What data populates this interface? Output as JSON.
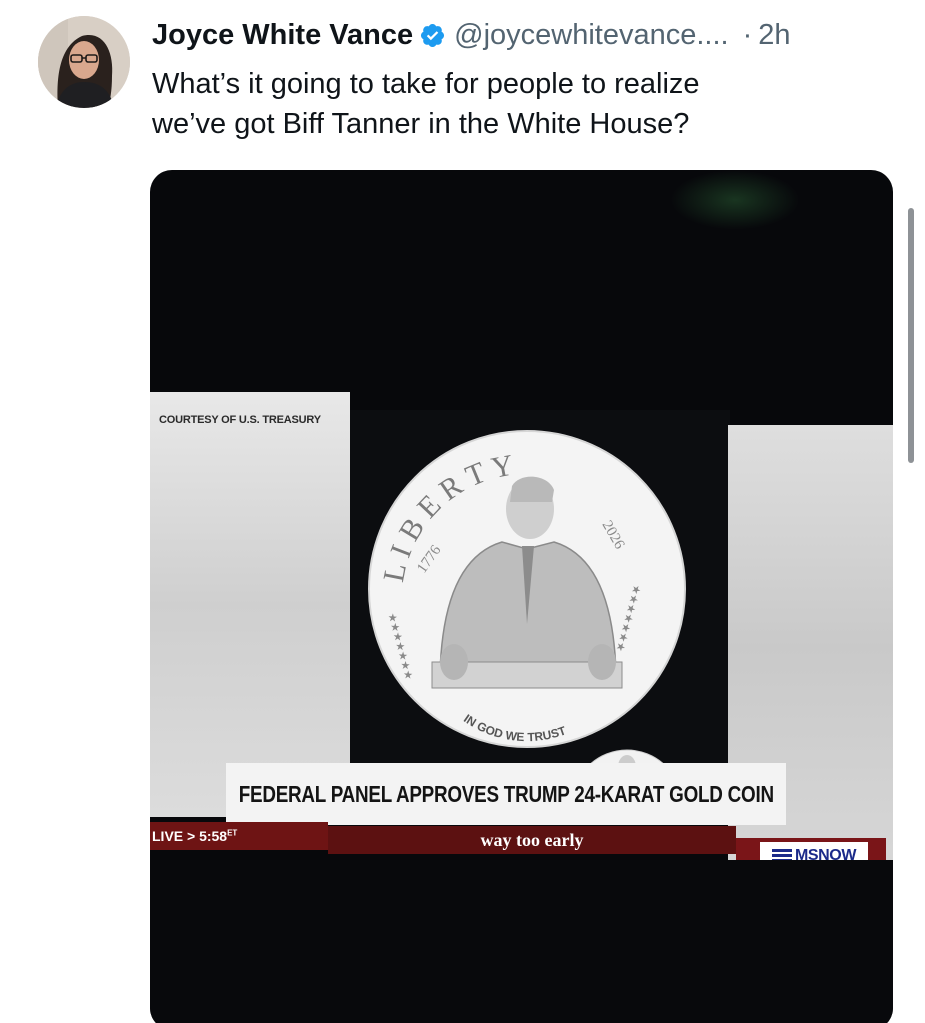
{
  "tweet": {
    "author_name": "Joyce White Vance",
    "handle": "@joycewhitevance....",
    "separator": "·",
    "time": "2h",
    "text_lines": [
      "What’s it going to take for people to realize",
      "we’ve got Biff Tanner in the White House?"
    ]
  },
  "media": {
    "courtesy": "COURTESY OF U.S. TREASURY",
    "coin": {
      "letters": [
        "L",
        "I",
        "B",
        "E",
        "R",
        "T",
        "Y"
      ],
      "year_left": "1776",
      "year_right": "2026",
      "motto": "IN GOD WE TRUST"
    },
    "headline": "FEDERAL PANEL APPROVES TRUMP 24-KARAT GOLD COIN",
    "live": "LIVE > 5:58",
    "live_tz": "ET",
    "show": "way too early",
    "network": "MSNOW"
  },
  "colors": {
    "verified": "#1d9bf0",
    "text": "#0f1419",
    "secondary": "#536471",
    "chyron_red": "#6e1414",
    "network_blue": "#1b2a8a"
  },
  "icons": {
    "verified": "verified-badge-icon",
    "avatar": "profile-avatar"
  }
}
